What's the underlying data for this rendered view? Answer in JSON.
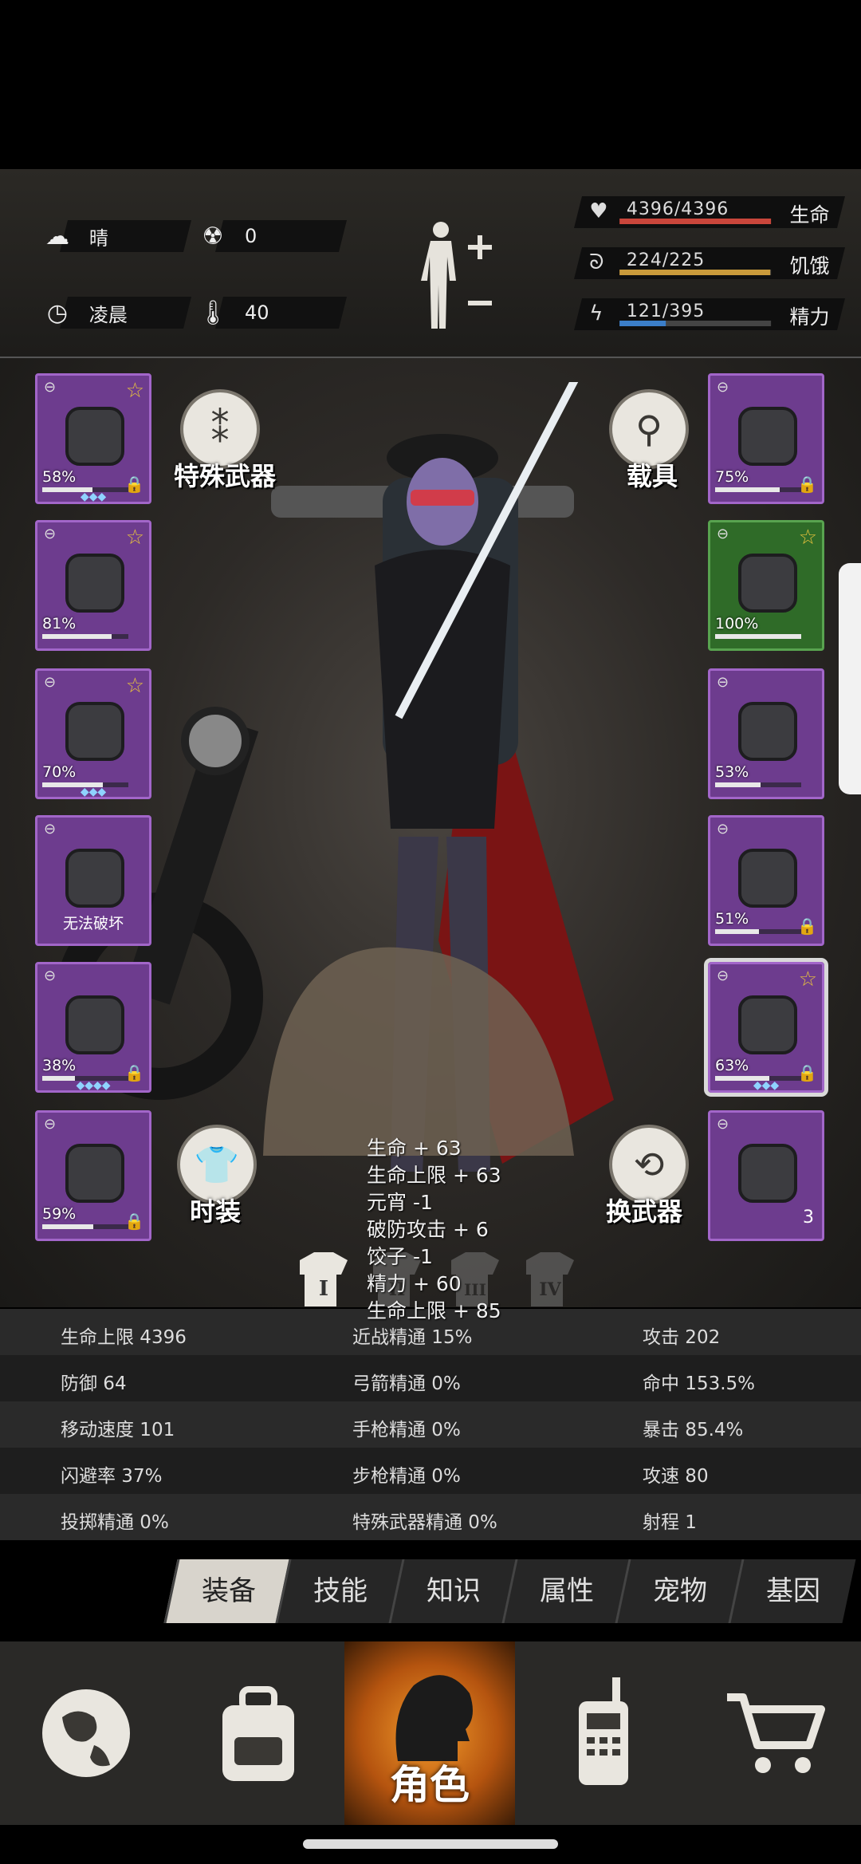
{
  "status": {
    "weather": "晴",
    "radiation": "0",
    "time_of_day": "凌晨",
    "temperature": "40",
    "bars": [
      {
        "label": "生命",
        "value": "4396/4396",
        "fill": 1.0,
        "color": "#c9463b",
        "icon": "heart-icon"
      },
      {
        "label": "饥饿",
        "value": "224/225",
        "fill": 0.995,
        "color": "#c99a3b",
        "icon": "stomach-icon"
      },
      {
        "label": "精力",
        "value": "121/395",
        "fill": 0.306,
        "color": "#3b7ec9",
        "icon": "energy-icon"
      }
    ]
  },
  "left_slots": [
    {
      "pct": "58%",
      "dur": 0.58,
      "star": true,
      "lock": true,
      "gems": "◆◆◆"
    },
    {
      "pct": "81%",
      "dur": 0.81,
      "star": true,
      "lock": false,
      "gems": ""
    },
    {
      "pct": "70%",
      "dur": 0.7,
      "star": true,
      "lock": false,
      "gems": "◆◆◆"
    },
    {
      "pct": "",
      "dur": 0,
      "star": false,
      "lock": false,
      "gems": "",
      "text": "无法破坏"
    },
    {
      "pct": "38%",
      "dur": 0.38,
      "star": false,
      "lock": true,
      "gems": "◆◆◆◆"
    },
    {
      "pct": "59%",
      "dur": 0.59,
      "star": false,
      "lock": true,
      "gems": ""
    }
  ],
  "right_slots": [
    {
      "pct": "75%",
      "dur": 0.75,
      "star": false,
      "lock": true,
      "gems": ""
    },
    {
      "pct": "100%",
      "dur": 1.0,
      "star": true,
      "lock": false,
      "gems": ""
    },
    {
      "pct": "53%",
      "dur": 0.53,
      "star": false,
      "lock": false,
      "gems": ""
    },
    {
      "pct": "51%",
      "dur": 0.51,
      "star": false,
      "lock": true,
      "gems": ""
    },
    {
      "pct": "63%",
      "dur": 0.63,
      "star": true,
      "lock": true,
      "gems": "◆◆◆"
    },
    {
      "pct": "",
      "dur": 0,
      "star": false,
      "lock": false,
      "gems": "",
      "count": "3"
    }
  ],
  "buttons": {
    "special_weapon": "特殊武器",
    "vehicle": "载具",
    "fashion": "时装",
    "swap_weapon": "换武器"
  },
  "popup": [
    "生命 + 63",
    "生命上限 + 63",
    "元宵 -1",
    "破防攻击 + 6",
    "饺子 -1",
    "精力 + 60",
    "生命上限 + 85"
  ],
  "outfit_tabs": [
    "I",
    "II",
    "III",
    "IV"
  ],
  "stats": [
    [
      "生命上限 4396",
      "近战精通 15%",
      "攻击 202"
    ],
    [
      "防御 64",
      "弓箭精通 0%",
      "命中 153.5%"
    ],
    [
      "移动速度 101",
      "手枪精通 0%",
      "暴击 85.4%"
    ],
    [
      "闪避率 37%",
      "步枪精通 0%",
      "攻速 80"
    ],
    [
      "投掷精通 0%",
      "特殊武器精通 0%",
      "射程 1"
    ]
  ],
  "tabs": [
    "装备",
    "技能",
    "知识",
    "属性",
    "宠物",
    "基因"
  ],
  "nav": {
    "character_label": "角色"
  }
}
